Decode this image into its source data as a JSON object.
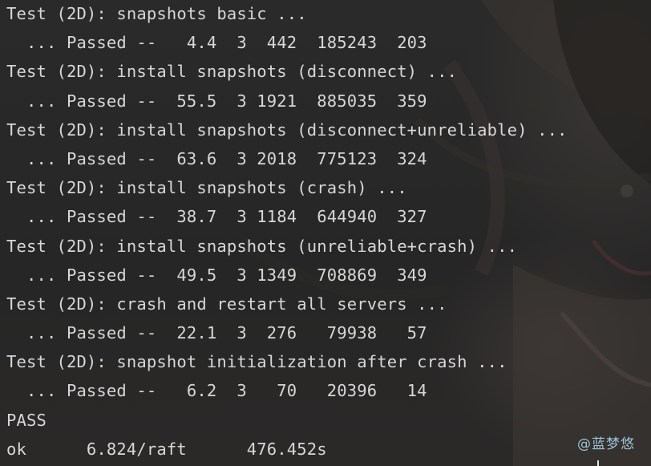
{
  "terminal": {
    "lines": [
      "Test (2D): snapshots basic ...",
      "  ... Passed --   4.4  3  442  185243  203",
      "Test (2D): install snapshots (disconnect) ...",
      "  ... Passed --  55.5  3 1921  885035  359",
      "Test (2D): install snapshots (disconnect+unreliable) ...",
      "  ... Passed --  63.6  3 2018  775123  324",
      "Test (2D): install snapshots (crash) ...",
      "  ... Passed --  38.7  3 1184  644940  327",
      "Test (2D): install snapshots (unreliable+crash) ...",
      "  ... Passed --  49.5  3 1349  708869  349",
      "Test (2D): crash and restart all servers ...",
      "  ... Passed --  22.1  3  276   79938   57",
      "Test (2D): snapshot initialization after crash ...",
      "  ... Passed --   6.2  3   70   20396   14",
      "PASS",
      "ok      6.824/raft      476.452s"
    ]
  },
  "watermark": "@蓝梦悠",
  "colors": {
    "text": "#d7d7d7",
    "background": "#262626",
    "watermark": "#9ec3d6"
  }
}
